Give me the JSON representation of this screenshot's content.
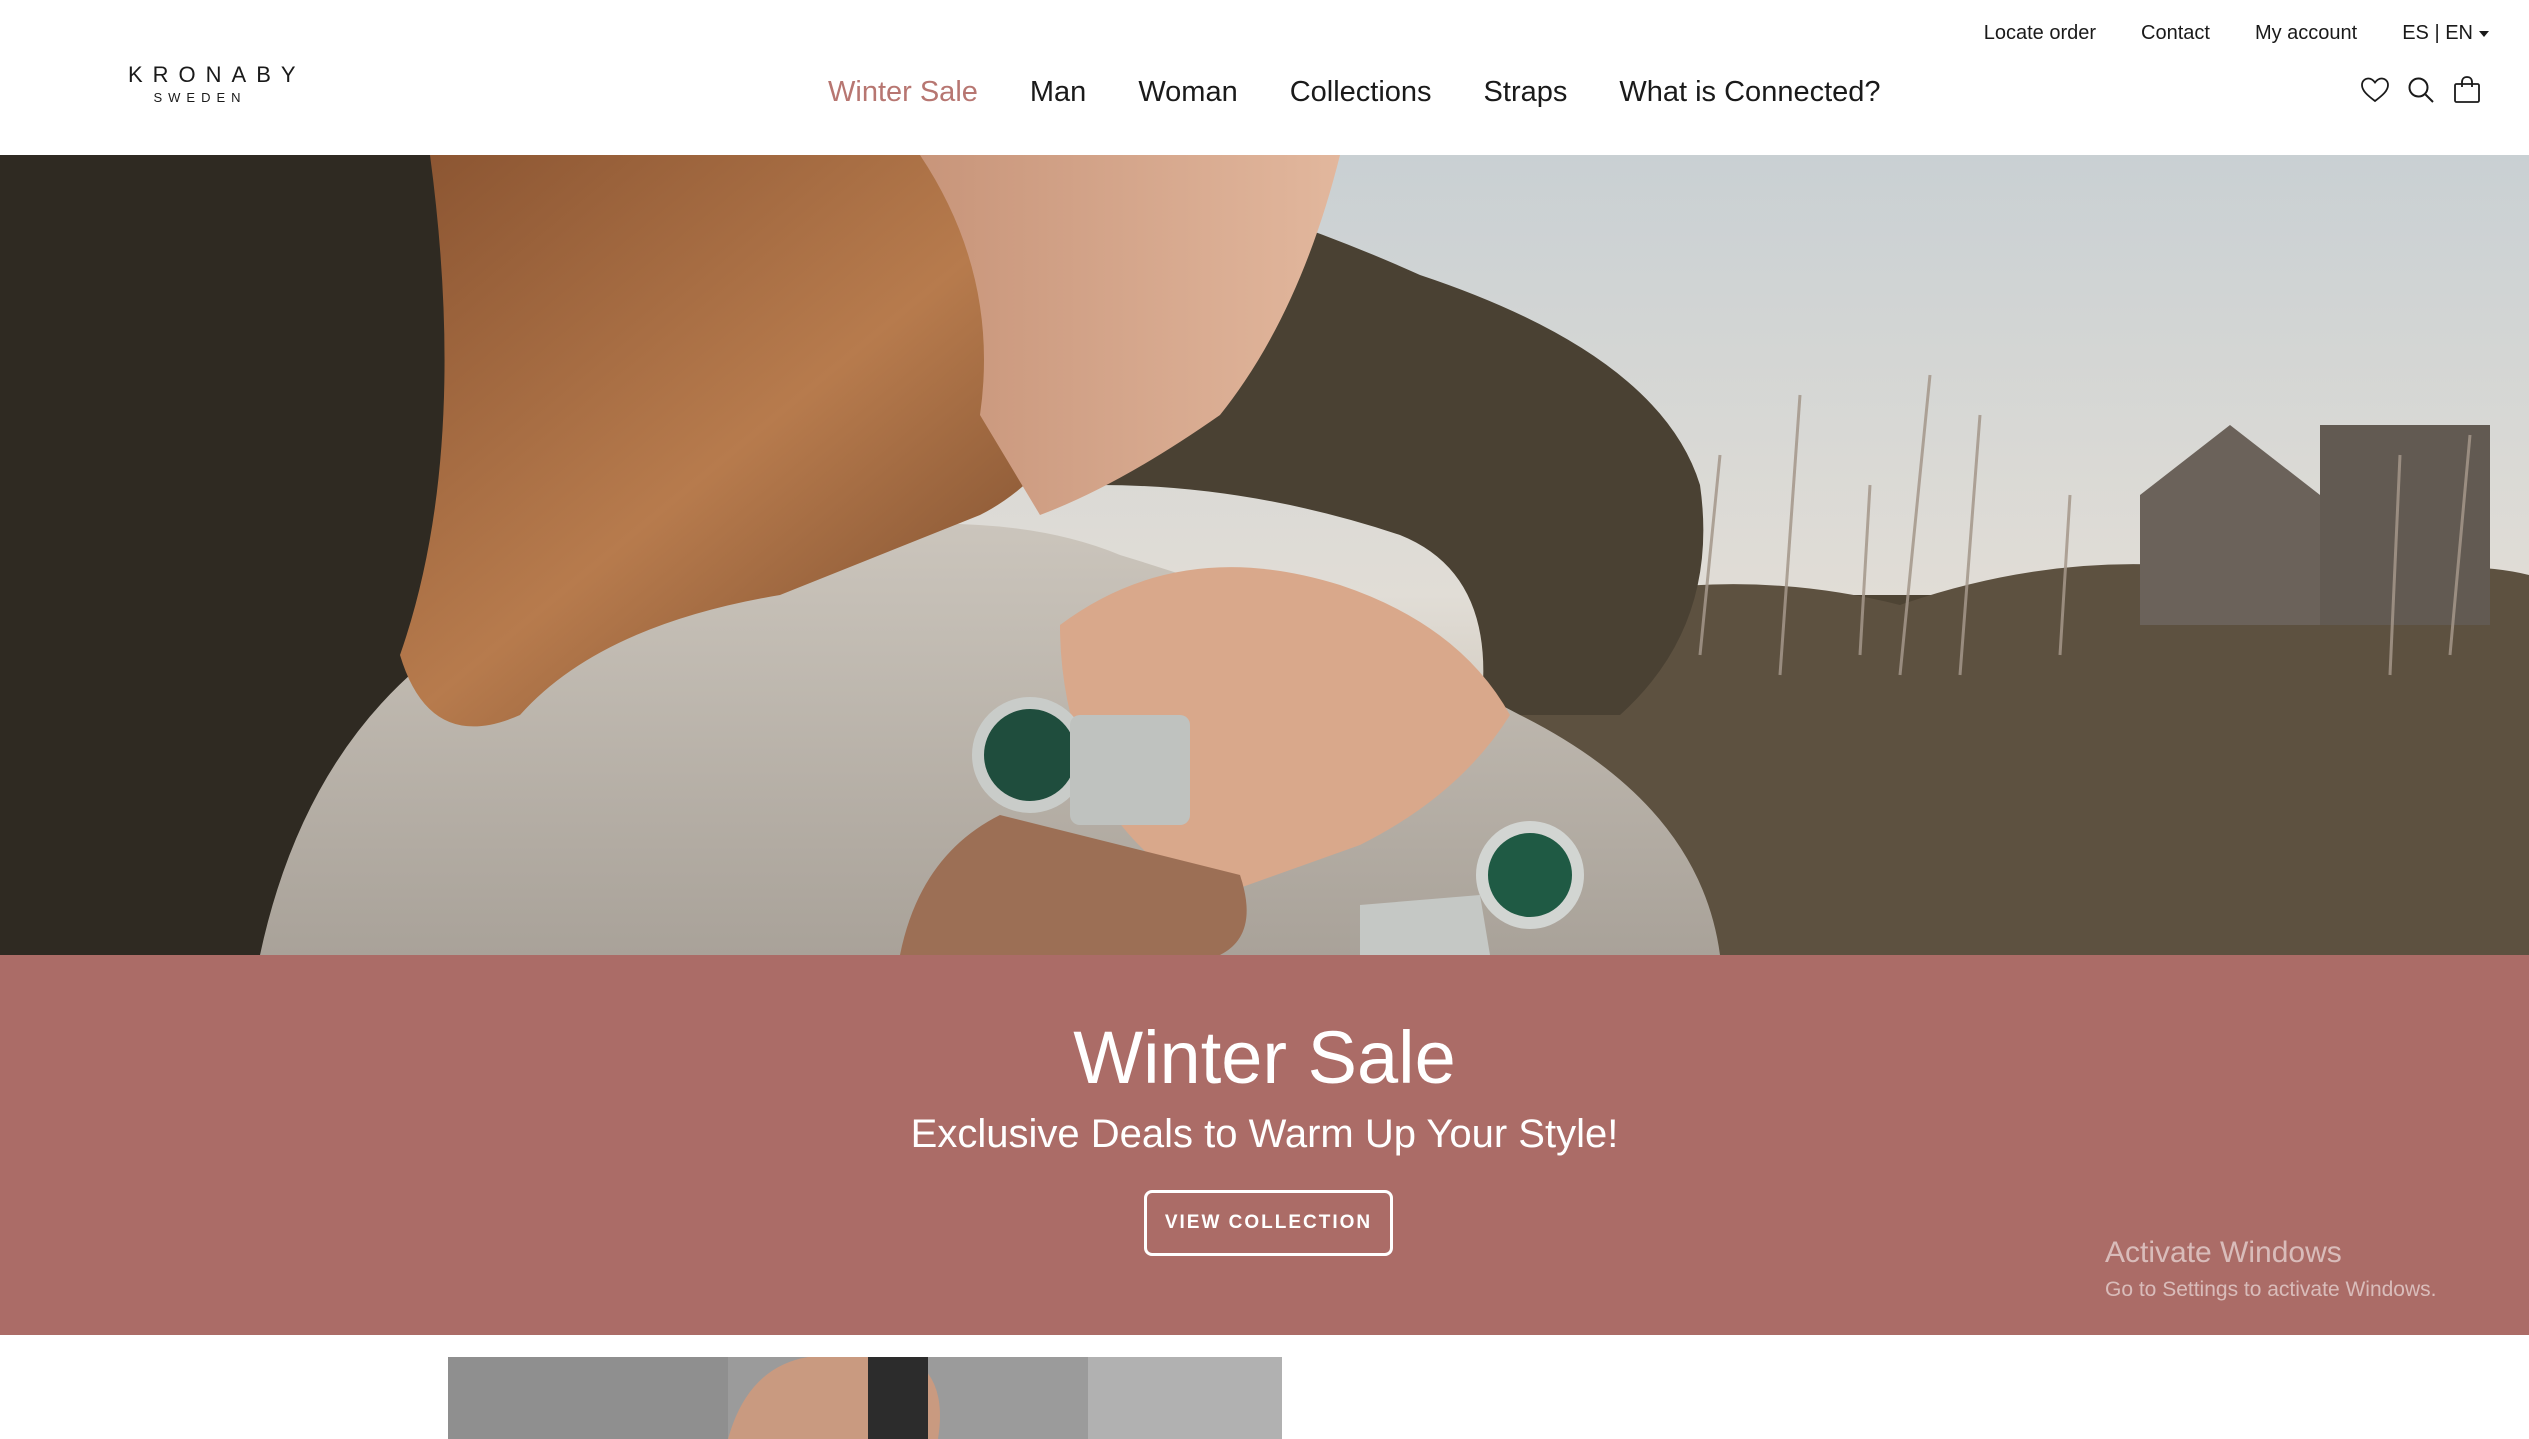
{
  "brand": {
    "name": "KRONABY",
    "subline": "SWEDEN"
  },
  "colors": {
    "accent": "#b77671",
    "promo_band": "#ab6c67",
    "text": "#1a1a1a"
  },
  "utility_nav": {
    "locate_order": "Locate order",
    "contact": "Contact",
    "my_account": "My account",
    "language": "ES | EN"
  },
  "main_nav": [
    {
      "label": "Winter Sale",
      "active": true
    },
    {
      "label": "Man"
    },
    {
      "label": "Woman"
    },
    {
      "label": "Collections"
    },
    {
      "label": "Straps"
    },
    {
      "label": "What is Connected?"
    }
  ],
  "header_icons": [
    "heart-icon",
    "search-icon",
    "shopping-bag-icon"
  ],
  "hero": {
    "image": "couple embracing wearing matching green-dial watches in a field"
  },
  "promo": {
    "title": "Winter Sale",
    "subtitle": "Exclusive Deals to Warm Up Your Style!",
    "button": "VIEW COLLECTION"
  },
  "os_watermark": {
    "title": "Activate Windows",
    "subtitle": "Go to Settings to activate Windows."
  }
}
